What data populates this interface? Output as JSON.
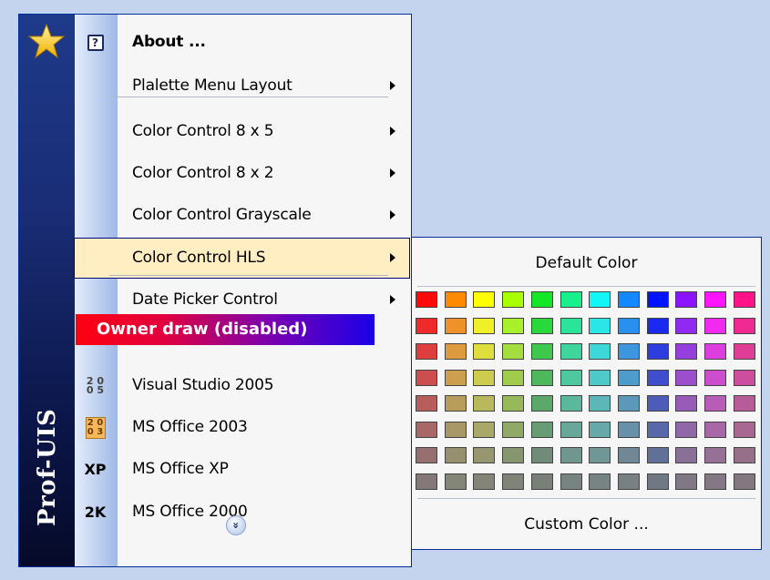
{
  "menu": {
    "brand_text": "Prof-UIS",
    "items": [
      {
        "label": "About ...",
        "icon": "help-icon",
        "icon_text": "?",
        "submenu": false,
        "bold": true
      },
      {
        "label": "Plalette Menu Layout",
        "icon": "",
        "submenu": true
      },
      {
        "label": "Color Control 8 x 5",
        "icon": "",
        "submenu": true
      },
      {
        "label": "Color Control 8 x 2",
        "icon": "",
        "submenu": true
      },
      {
        "label": "Color Control Grayscale",
        "icon": "",
        "submenu": true
      },
      {
        "label": "Color Control HLS",
        "icon": "",
        "submenu": true,
        "highlighted": true
      },
      {
        "label": "Date Picker Control",
        "icon": "",
        "submenu": true
      },
      {
        "label": "Visual Studio 2005",
        "icon": "vs2005-icon",
        "icon_text": "2 0\n0 5",
        "submenu": false
      },
      {
        "label": "MS Office 2003",
        "icon": "office2003-icon",
        "icon_text": "2 0\n0 3",
        "submenu": false
      },
      {
        "label": "MS Office XP",
        "icon": "officexp-icon",
        "icon_text": "XP",
        "submenu": false
      },
      {
        "label": "MS Office 2000",
        "icon": "office2000-icon",
        "icon_text": "2K",
        "submenu": false
      }
    ],
    "owner_draw_label": "Owner draw (disabled)",
    "expand_icon": "double-chevron-down-icon",
    "expand_glyph": "»"
  },
  "submenu": {
    "default_label": "Default Color",
    "custom_label": "Custom Color ...",
    "palette_rows": [
      [
        "#ff0a0a",
        "#ff8a00",
        "#ffff00",
        "#a8ff00",
        "#14e628",
        "#18f08c",
        "#14f5f5",
        "#1488ff",
        "#0014ff",
        "#8a14ff",
        "#ff14ff",
        "#ff1488"
      ],
      [
        "#f02a2a",
        "#f0922a",
        "#f0f02a",
        "#a8f02a",
        "#2ad83c",
        "#2ae49a",
        "#2ae6e6",
        "#2a90f0",
        "#1a2af0",
        "#902af0",
        "#f02af0",
        "#f02a90"
      ],
      [
        "#de3e3e",
        "#de9a3e",
        "#dede3e",
        "#a4de3e",
        "#3ec84e",
        "#3ed69c",
        "#3ed8d8",
        "#3e96de",
        "#2e3ede",
        "#963ede",
        "#de3ede",
        "#de3e96"
      ],
      [
        "#cc4e4e",
        "#cca04e",
        "#cccc4e",
        "#a0cc4e",
        "#4eb85e",
        "#4ec89e",
        "#4ecaca",
        "#4e9ccc",
        "#3e4ecc",
        "#9c4ecc",
        "#cc4ecc",
        "#cc4e9c"
      ],
      [
        "#b85c5c",
        "#b89c5c",
        "#b8b85c",
        "#98b85c",
        "#5ca86a",
        "#5cb89c",
        "#5cb8b8",
        "#5c98b8",
        "#4c5cb8",
        "#985cb8",
        "#b85cb8",
        "#b85c98"
      ],
      [
        "#a86868",
        "#a89868",
        "#a8a868",
        "#90a868",
        "#689c74",
        "#68a898",
        "#68a8a8",
        "#6890a8",
        "#5868a8",
        "#9068a8",
        "#a868a8",
        "#a86890"
      ],
      [
        "#967070",
        "#969070",
        "#969670",
        "#889670",
        "#708c78",
        "#709690",
        "#709696",
        "#708896",
        "#607096",
        "#887096",
        "#967096",
        "#967088"
      ],
      [
        "#847878",
        "#848678",
        "#848478",
        "#808478",
        "#788078",
        "#788482",
        "#788484",
        "#788084",
        "#707884",
        "#807884",
        "#847884",
        "#847880"
      ]
    ]
  }
}
